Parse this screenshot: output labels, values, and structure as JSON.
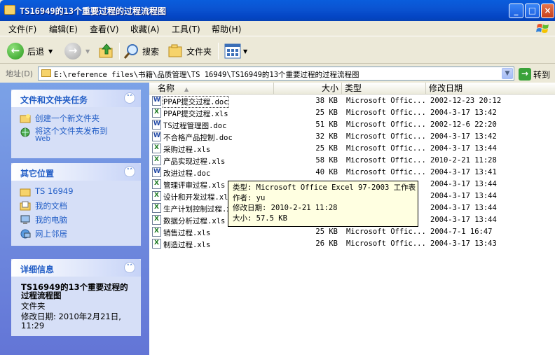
{
  "window": {
    "title": "TS16949的13个重要过程的过程流程图",
    "controls": [
      "_",
      "□",
      "×"
    ]
  },
  "menu": [
    "文件(F)",
    "编辑(E)",
    "查看(V)",
    "收藏(A)",
    "工具(T)",
    "帮助(H)"
  ],
  "toolbar": {
    "back": "后退",
    "search": "搜索",
    "folders": "文件夹"
  },
  "address": {
    "label": "地址(D)",
    "path": "E:\\reference files\\书籍\\品质管理\\TS 16949\\TS16949的13个重要过程的过程流程图",
    "go": "转到"
  },
  "tasks_panel": {
    "title": "文件和文件夹任务",
    "links": [
      {
        "icon": "new-folder-icon",
        "label": "创建一个新文件夹"
      },
      {
        "icon": "publish-web-icon",
        "label": "将这个文件夹发布到",
        "label2": "Web"
      }
    ]
  },
  "places_panel": {
    "title": "其它位置",
    "links": [
      {
        "icon": "folder-icon",
        "label": "TS 16949"
      },
      {
        "icon": "my-documents-icon",
        "label": "我的文档"
      },
      {
        "icon": "my-computer-icon",
        "label": "我的电脑"
      },
      {
        "icon": "network-icon",
        "label": "网上邻居"
      }
    ]
  },
  "details_panel": {
    "title": "详细信息",
    "name_line1": "TS16949的13个重要过程的",
    "name_line2": "过程流程图",
    "kind": "文件夹",
    "modified_line1": "修改日期: 2010年2月21日,",
    "modified_line2": "11:29"
  },
  "columns": {
    "name": "名称",
    "size": "大小",
    "type": "类型",
    "modified": "修改日期"
  },
  "files": [
    {
      "name": "PPAP提交过程.doc",
      "ext": "doc",
      "size": "38 KB",
      "type": "Microsoft Offic...",
      "modified": "2002-12-23 20:12"
    },
    {
      "name": "PPAP提交过程.xls",
      "ext": "xls",
      "size": "25 KB",
      "type": "Microsoft Offic...",
      "modified": "2004-3-17 13:42"
    },
    {
      "name": "TS过程管理图.doc",
      "ext": "doc",
      "size": "51 KB",
      "type": "Microsoft Offic...",
      "modified": "2002-12-6 22:20"
    },
    {
      "name": "不合格产品控制.doc",
      "ext": "doc",
      "size": "32 KB",
      "type": "Microsoft Offic...",
      "modified": "2004-3-17 13:42"
    },
    {
      "name": "采购过程.xls",
      "ext": "xls",
      "size": "25 KB",
      "type": "Microsoft Offic...",
      "modified": "2004-3-17 13:44"
    },
    {
      "name": "产品实现过程.xls",
      "ext": "xls",
      "size": "58 KB",
      "type": "Microsoft Offic...",
      "modified": "2010-2-21 11:28"
    },
    {
      "name": "改进过程.doc",
      "ext": "doc",
      "size": "40 KB",
      "type": "Microsoft Offic...",
      "modified": "2004-3-17 13:41"
    },
    {
      "name": "管理评审过程.xls",
      "ext": "xls",
      "size": "",
      "type": "",
      "modified": "2004-3-17 13:44"
    },
    {
      "name": "设计和开发过程.xls",
      "ext": "xls",
      "size": "",
      "type": "",
      "modified": "2004-3-17 13:44"
    },
    {
      "name": "生产计划控制过程.xls",
      "ext": "xls",
      "size": "",
      "type": "",
      "modified": "2004-3-17 13:44"
    },
    {
      "name": "数据分析过程.xls",
      "ext": "xls",
      "size": "",
      "type": "",
      "modified": "2004-3-17 13:44"
    },
    {
      "name": "销售过程.xls",
      "ext": "xls",
      "size": "25 KB",
      "type": "Microsoft Offic...",
      "modified": "2004-7-1 16:47"
    },
    {
      "name": "制造过程.xls",
      "ext": "xls",
      "size": "26 KB",
      "type": "Microsoft Offic...",
      "modified": "2004-3-17 13:43"
    }
  ],
  "tooltip": {
    "type": "类型: Microsoft Office Excel 97-2003 工作表",
    "author": "作者: yu",
    "modified": "修改日期: 2010-2-21 11:28",
    "size": "大小: 57.5 KB"
  }
}
